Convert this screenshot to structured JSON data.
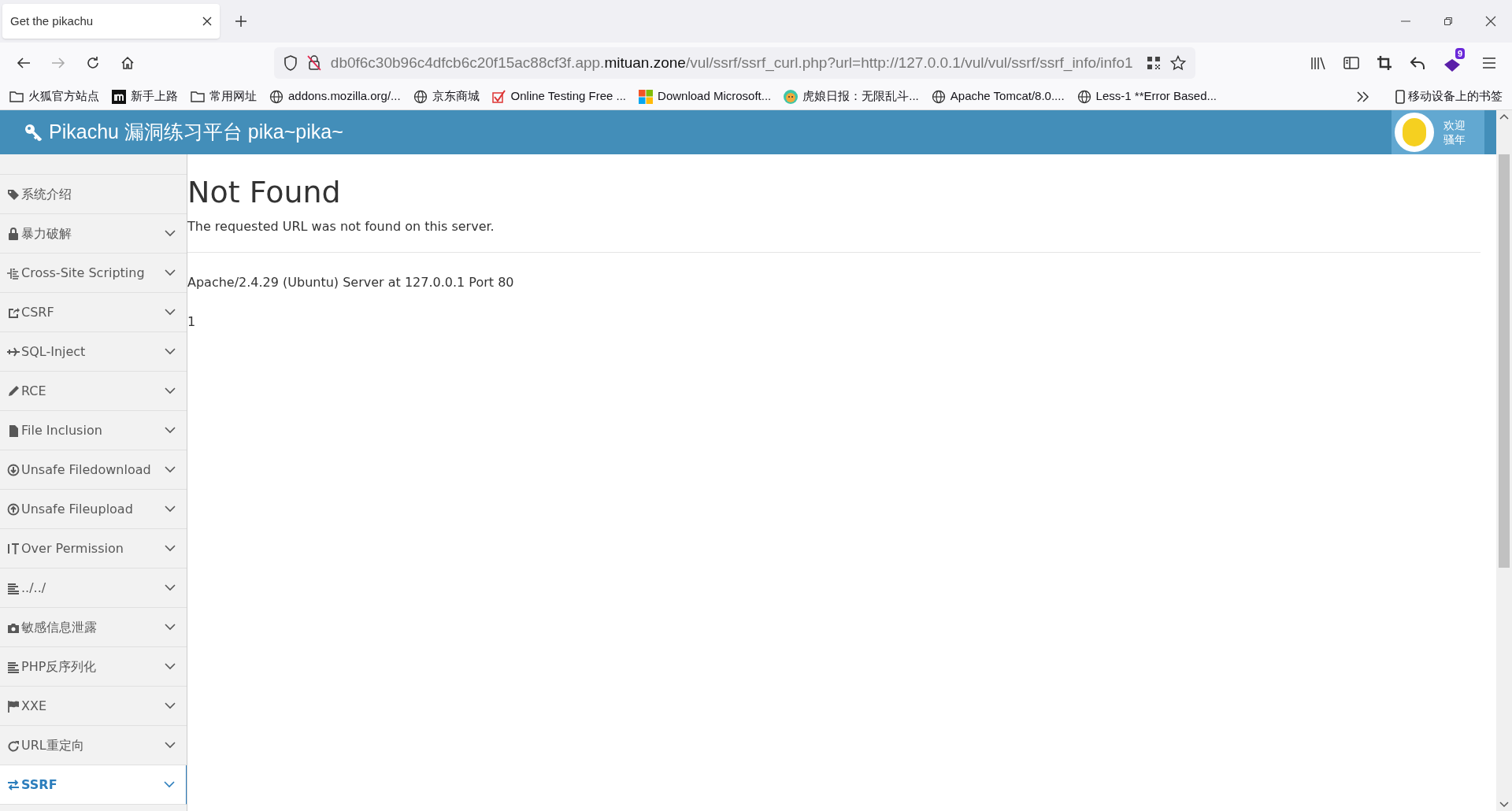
{
  "browser": {
    "tabs": [
      {
        "title": "Get the pikachu",
        "selected": true
      }
    ],
    "address": {
      "host_prefix": "db0f6c30b96c4dfcb6c20f15ac88cf3f.app.",
      "domain": "mituan.zone",
      "path": "/vul/ssrf/ssrf_curl.php?url=http://127.0.0.1/vul/vul/ssrf/ssrf_info/info1"
    },
    "extension_badge": "9",
    "bookmarks": [
      {
        "kind": "folder",
        "label": "火狐官方站点"
      },
      {
        "kind": "m",
        "label": "新手上路"
      },
      {
        "kind": "folder",
        "label": "常用网址"
      },
      {
        "kind": "globe",
        "label": "addons.mozilla.org/..."
      },
      {
        "kind": "globe",
        "label": "京东商城"
      },
      {
        "kind": "check",
        "label": "Online Testing Free ..."
      },
      {
        "kind": "windows",
        "label": "Download Microsoft..."
      },
      {
        "kind": "tiger",
        "label": "虎娘日报：无限乱斗..."
      },
      {
        "kind": "globe",
        "label": "Apache Tomcat/8.0...."
      },
      {
        "kind": "globe",
        "label": "Less-1 **Error Based..."
      }
    ],
    "mobile_bookmarks": "移动设备上的书签"
  },
  "site_header": {
    "title": "Pikachu 漏洞练习平台 pika~pika~",
    "welcome": [
      "欢迎",
      "骚年"
    ]
  },
  "sidebar": {
    "items": [
      {
        "kind": "tag",
        "label": "系统介绍",
        "expandable": false,
        "selected": false
      },
      {
        "kind": "lock",
        "label": "暴力破解",
        "expandable": true,
        "selected": false
      },
      {
        "kind": "list",
        "label": "Cross-Site Scripting",
        "expandable": true,
        "selected": false
      },
      {
        "kind": "share",
        "label": "CSRF",
        "expandable": true,
        "selected": false
      },
      {
        "kind": "plane",
        "label": "SQL-Inject",
        "expandable": true,
        "selected": false
      },
      {
        "kind": "pencil",
        "label": "RCE",
        "expandable": true,
        "selected": false
      },
      {
        "kind": "file",
        "label": "File Inclusion",
        "expandable": true,
        "selected": false
      },
      {
        "kind": "down",
        "label": "Unsafe Filedownload",
        "expandable": true,
        "selected": false
      },
      {
        "kind": "up",
        "label": "Unsafe Fileupload",
        "expandable": true,
        "selected": false
      },
      {
        "kind": "text",
        "label": "Over Permission",
        "expandable": true,
        "selected": false
      },
      {
        "kind": "lines",
        "label": "../../",
        "expandable": true,
        "selected": false
      },
      {
        "kind": "camera",
        "label": "敏感信息泄露",
        "expandable": true,
        "selected": false
      },
      {
        "kind": "lines",
        "label": "PHP反序列化",
        "expandable": true,
        "selected": false
      },
      {
        "kind": "flag",
        "label": "XXE",
        "expandable": true,
        "selected": false
      },
      {
        "kind": "refresh",
        "label": "URL重定向",
        "expandable": true,
        "selected": false
      },
      {
        "kind": "exchange",
        "label": "SSRF",
        "expandable": true,
        "selected": true
      }
    ]
  },
  "content": {
    "heading": "Not Found",
    "message": "The requested URL was not found on this server.",
    "server_signature": "Apache/2.4.29 (Ubuntu) Server at 127.0.0.1 Port 80",
    "output": "1"
  }
}
